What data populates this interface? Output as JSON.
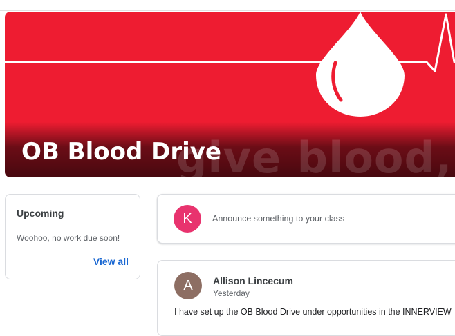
{
  "banner": {
    "class_title": "OB Blood Drive",
    "tagline": "give blood, give"
  },
  "upcoming": {
    "heading": "Upcoming",
    "note": "Woohoo, no work due soon!",
    "view_all_label": "View all"
  },
  "announce": {
    "avatar_letter": "K",
    "prompt": "Announce something to your class"
  },
  "post": {
    "avatar_letter": "A",
    "author": "Allison Lincecum",
    "time": "Yesterday",
    "body": "I have set up the OB Blood Drive under opportunities in the INNERVIEW"
  },
  "colors": {
    "banner_red": "#ee1c31",
    "link_blue": "#1967d2",
    "announce_avatar": "#e8336e",
    "post_avatar": "#8d6e63"
  }
}
